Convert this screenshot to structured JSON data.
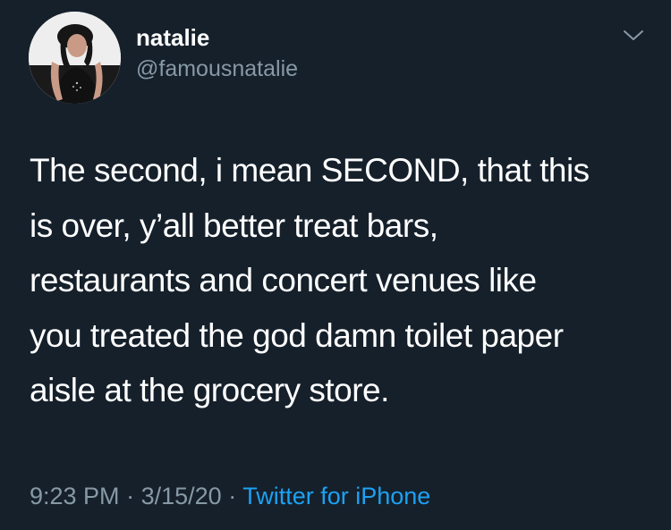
{
  "user": {
    "display_name": "natalie",
    "handle": "@famousnatalie",
    "avatar_icon": "profile-photo"
  },
  "tweet": {
    "lines": [
      "The second, i mean SECOND, that this",
      "is over, y’all better treat bars,",
      "restaurants and concert venues like",
      "you treated the god damn toilet paper",
      "aisle at the grocery store."
    ]
  },
  "meta": {
    "time": "9:23 PM",
    "separator": "·",
    "date": "3/15/20",
    "source": "Twitter for iPhone"
  },
  "menu": {
    "icon": "chevron-down-icon"
  },
  "colors": {
    "background": "#15202b",
    "text": "#ffffff",
    "secondary": "#8899a6",
    "link": "#1da1f2"
  }
}
